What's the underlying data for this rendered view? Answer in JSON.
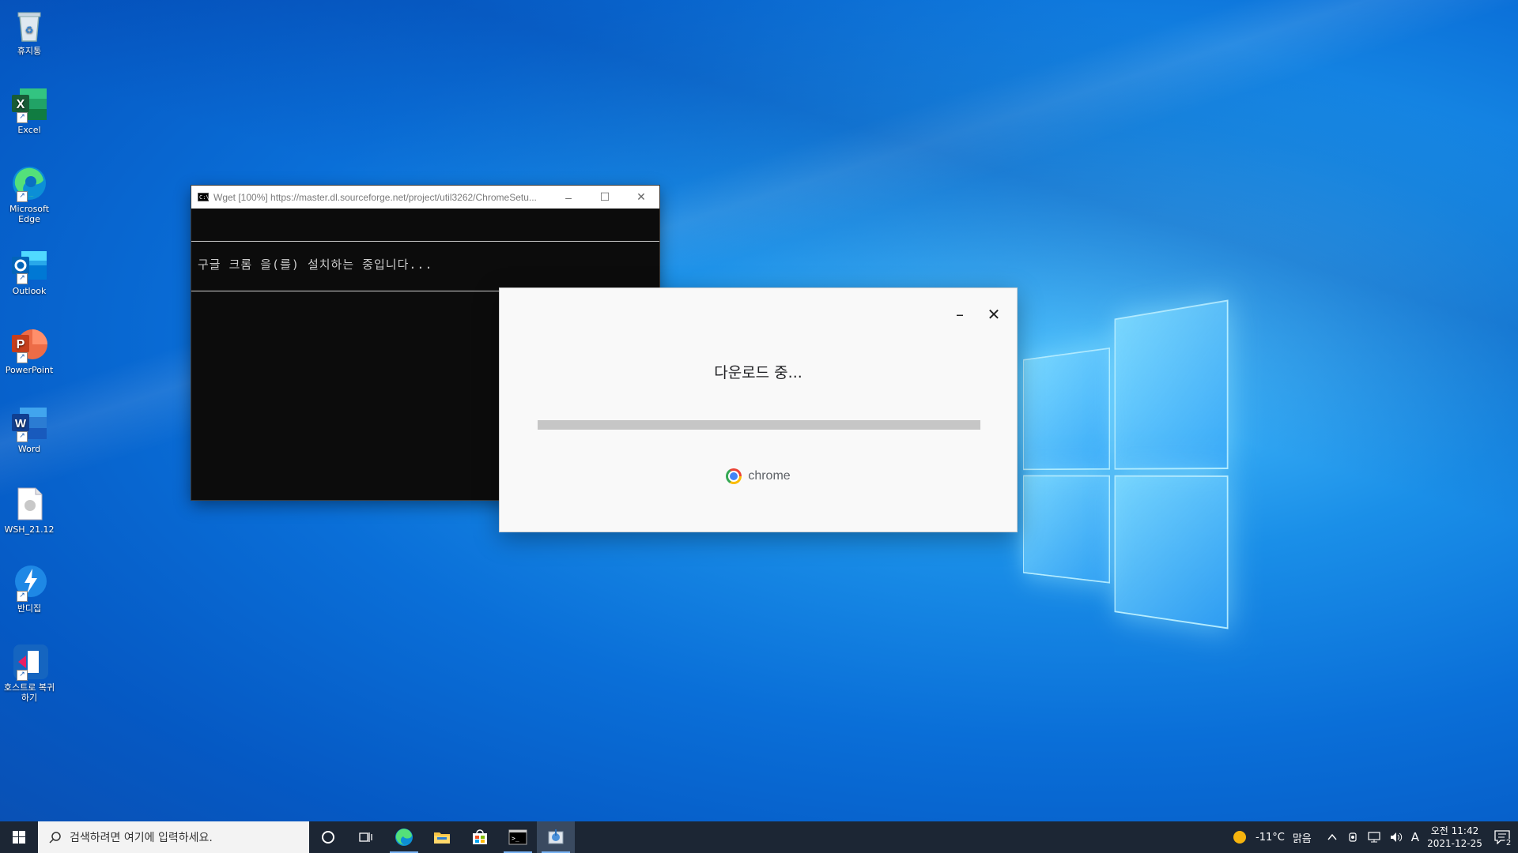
{
  "desktop": {
    "icons": [
      {
        "label": "휴지통"
      },
      {
        "label": "Excel"
      },
      {
        "label": "Microsoft Edge"
      },
      {
        "label": "Outlook"
      },
      {
        "label": "PowerPoint"
      },
      {
        "label": "Word"
      },
      {
        "label": "WSH_21.12"
      },
      {
        "label": "반디집"
      },
      {
        "label": "호스트로 복귀하기"
      }
    ]
  },
  "cmd_window": {
    "title": "Wget [100%] https://master.dl.sourceforge.net/project/util3262/ChromeSetu...",
    "message": "구글 크롬 을(를) 설치하는 중입니다...",
    "minimize_glyph": "–",
    "maximize_glyph": "☐",
    "close_glyph": "✕"
  },
  "installer": {
    "status": "다운로드 중...",
    "progress_percent": 100,
    "brand": "chrome",
    "minimize_glyph": "–",
    "close_glyph": "✕",
    "colors": {
      "bar": "#c6c6c6"
    }
  },
  "taskbar": {
    "search_placeholder": "검색하려면 여기에 입력하세요.",
    "apps": [
      {
        "name": "cortana-icon"
      },
      {
        "name": "task-view-icon"
      },
      {
        "name": "edge-icon"
      },
      {
        "name": "file-explorer-icon"
      },
      {
        "name": "store-icon"
      },
      {
        "name": "cmd-icon"
      },
      {
        "name": "installer-icon"
      }
    ],
    "weather": {
      "temp": "-11°C",
      "condition": "맑음"
    },
    "ime": "A",
    "clock": {
      "time": "오전 11:42",
      "date": "2021-12-25"
    },
    "notification_count": "2"
  }
}
